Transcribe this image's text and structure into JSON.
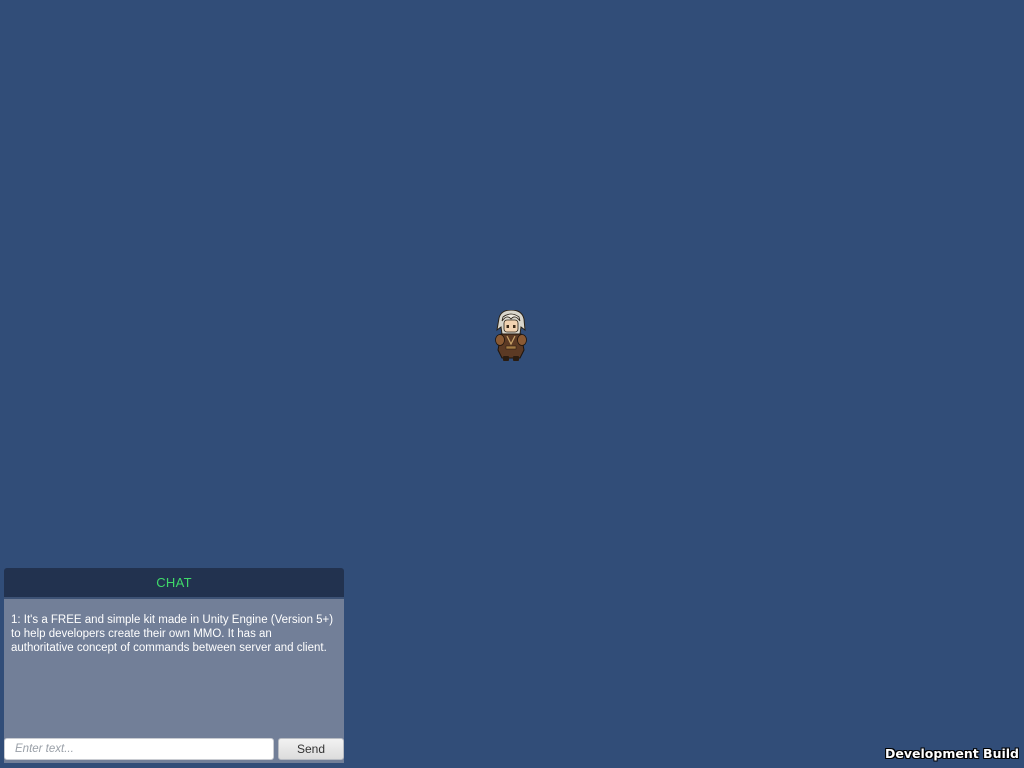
{
  "chat": {
    "title": "CHAT",
    "messages": [
      "1: It's a FREE and simple kit made in Unity Engine (Version 5+) to help developers create their own MMO. It has an authoritative concept of commands between server and client."
    ],
    "input_placeholder": "Enter text...",
    "input_value": "",
    "send_label": "Send"
  },
  "player": {
    "sprite_icon": "player-character-icon"
  },
  "build_label": "Development Build",
  "colors": {
    "background": "#314d78",
    "chat_header": "#22324f",
    "chat_title": "#3fd96a",
    "chat_body": "#727f98"
  }
}
